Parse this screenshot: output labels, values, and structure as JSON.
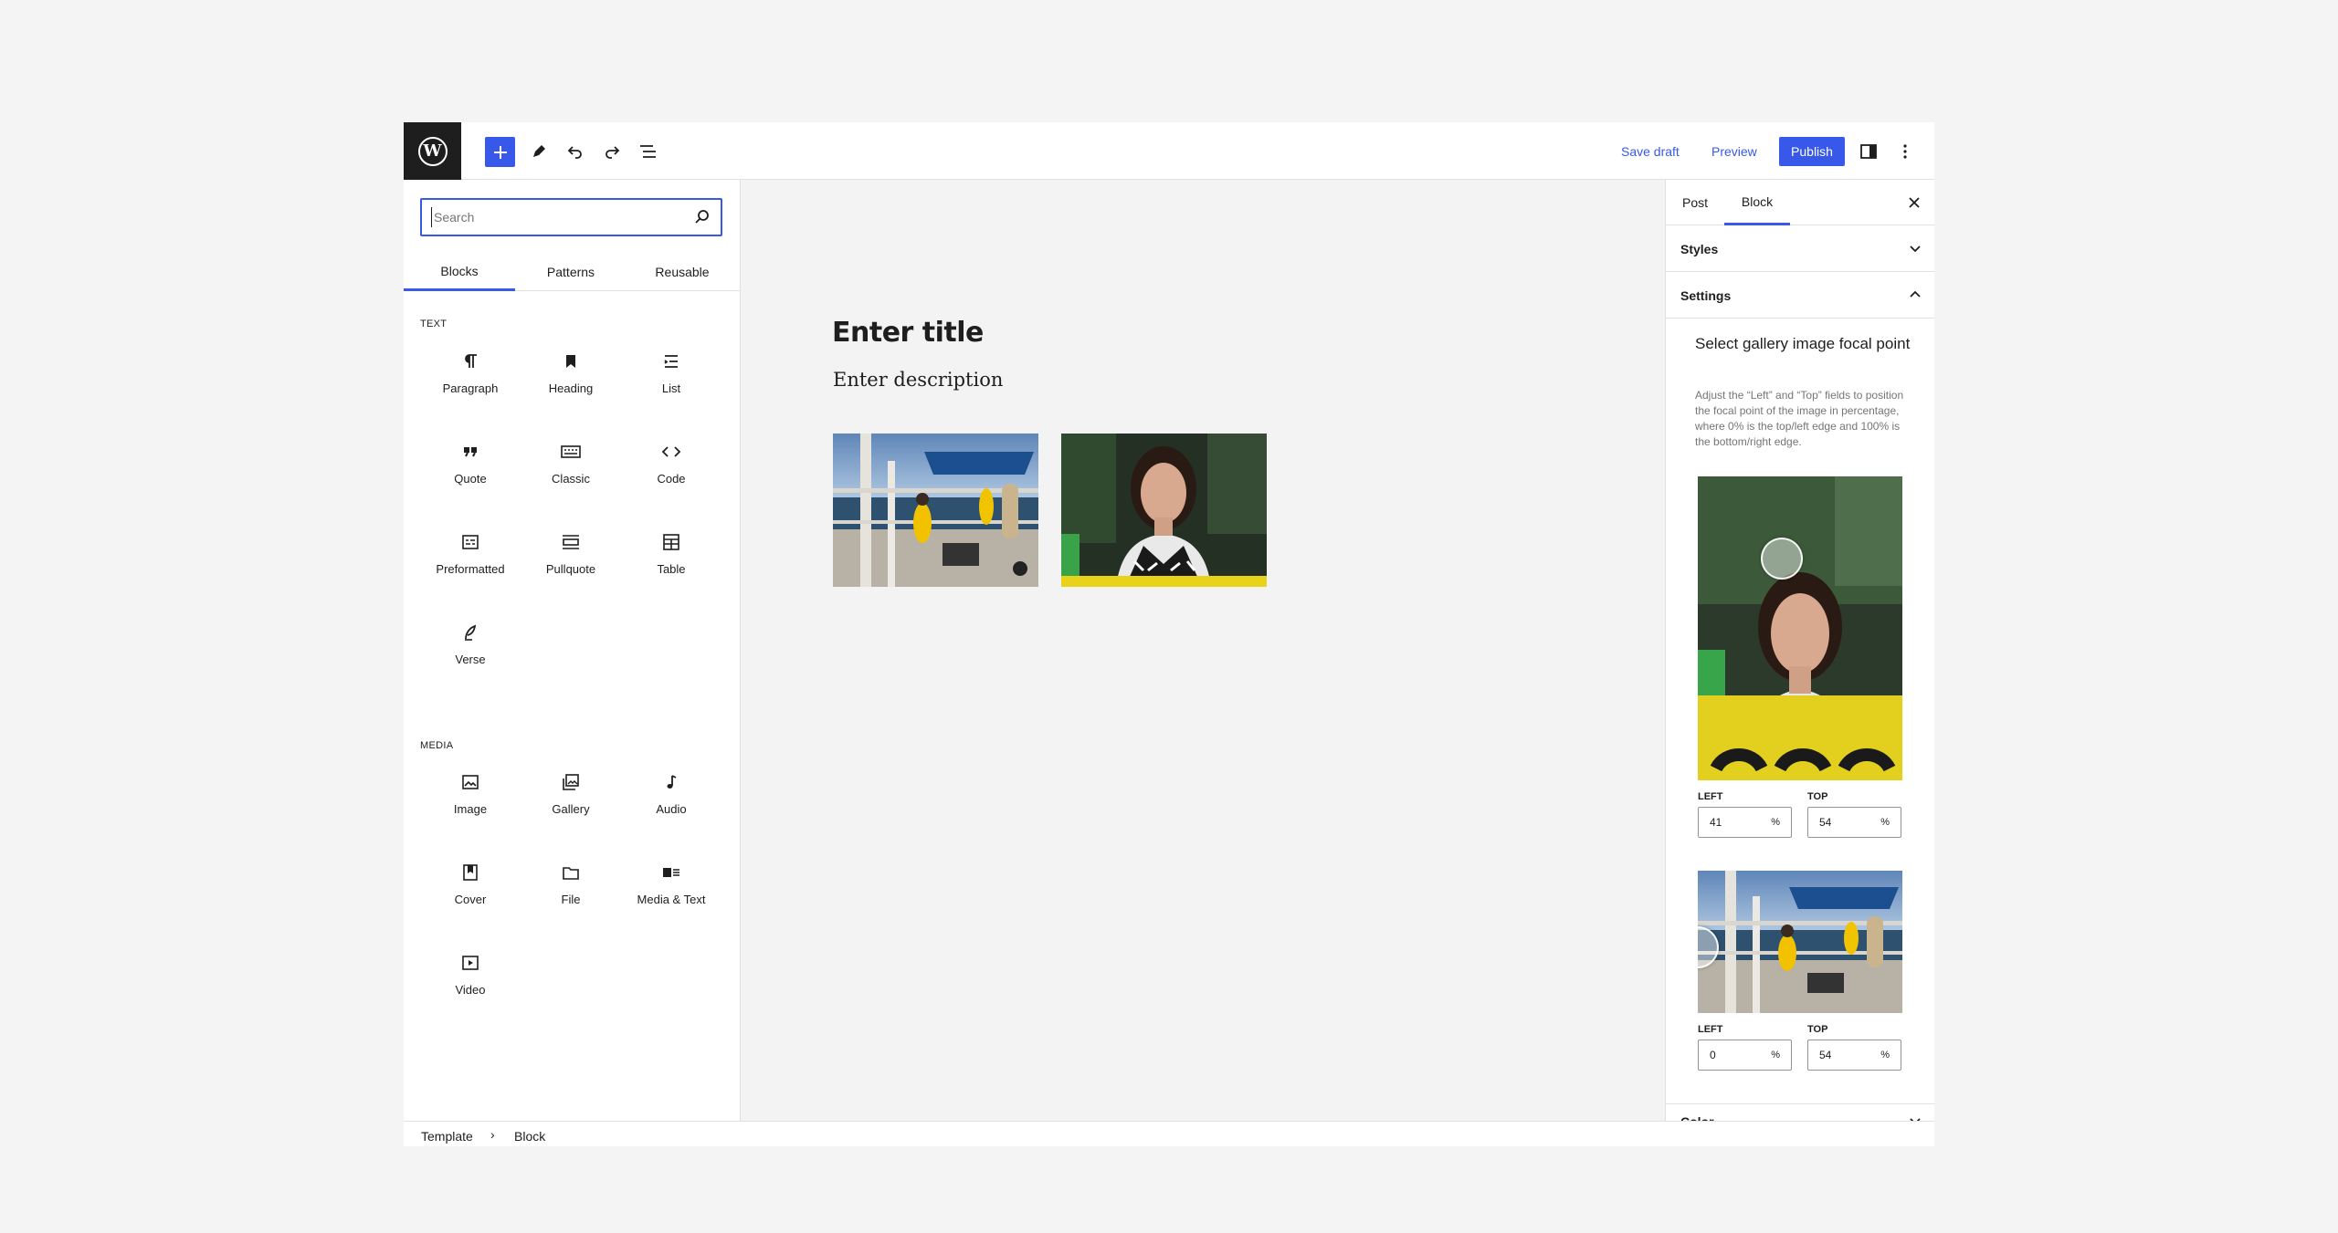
{
  "toolbar": {
    "logo_letter": "W",
    "add_icon": "plus-icon",
    "save_draft": "Save draft",
    "preview": "Preview",
    "publish": "Publish",
    "colors": {
      "accent": "#3858e9",
      "logo_bg": "#1e1e1e"
    }
  },
  "inserter": {
    "search_placeholder": "Search",
    "tabs": [
      "Blocks",
      "Patterns",
      "Reusable"
    ],
    "text_category": "TEXT",
    "text_blocks": [
      {
        "label": "Paragraph",
        "icon": "paragraph-icon"
      },
      {
        "label": "Heading",
        "icon": "heading-icon"
      },
      {
        "label": "List",
        "icon": "list-icon"
      },
      {
        "label": "Quote",
        "icon": "quote-icon"
      },
      {
        "label": "Classic",
        "icon": "keyboard-icon"
      },
      {
        "label": "Code",
        "icon": "code-icon"
      },
      {
        "label": "Preformatted",
        "icon": "preformatted-icon"
      },
      {
        "label": "Pullquote",
        "icon": "pullquote-icon"
      },
      {
        "label": "Table",
        "icon": "table-icon"
      },
      {
        "label": "Verse",
        "icon": "verse-icon"
      }
    ],
    "media_category": "MEDIA",
    "media_blocks": [
      {
        "label": "Image",
        "icon": "image-icon"
      },
      {
        "label": "Gallery",
        "icon": "gallery-icon"
      },
      {
        "label": "Audio",
        "icon": "audio-icon"
      },
      {
        "label": "Cover",
        "icon": "cover-icon"
      },
      {
        "label": "File",
        "icon": "file-icon"
      },
      {
        "label": "Media & Text",
        "icon": "media-text-icon"
      },
      {
        "label": "Video",
        "icon": "video-icon"
      }
    ]
  },
  "canvas": {
    "title": "Enter title",
    "description": "Enter description"
  },
  "sidebar": {
    "tabs": [
      "Post",
      "Block"
    ],
    "active_tab": "Block",
    "panels": {
      "styles": "Styles",
      "settings": "Settings",
      "color": "Color"
    },
    "focal_title": "Select gallery image focal point",
    "focal_help": "Adjust the “Left” and “Top” fields to position the focal point of the image in percentage, where 0% is the top/left edge and 100% is the bottom/right edge.",
    "images": [
      {
        "left_label": "LEFT",
        "top_label": "TOP",
        "left": "41",
        "top": "54",
        "unit": "%"
      },
      {
        "left_label": "LEFT",
        "top_label": "TOP",
        "left": "0",
        "top": "54",
        "unit": "%"
      }
    ]
  },
  "breadcrumb": [
    "Template",
    "Block"
  ]
}
